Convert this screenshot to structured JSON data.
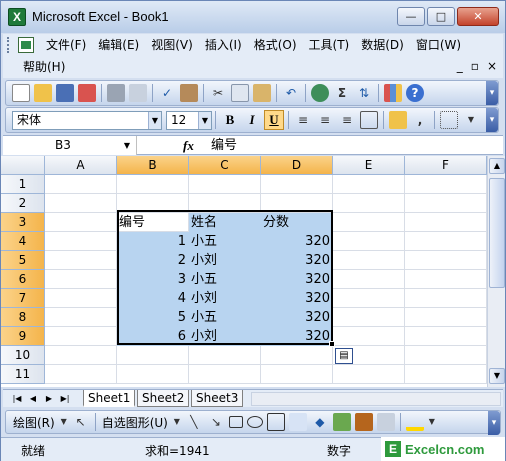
{
  "window": {
    "title": "Microsoft Excel - Book1",
    "app_icon_letter": "X",
    "minimize": "—",
    "maximize": "□",
    "close": "✕"
  },
  "menubar": {
    "items": [
      "文件(F)",
      "编辑(E)",
      "视图(V)",
      "插入(I)",
      "格式(O)",
      "工具(T)",
      "数据(D)",
      "窗口(W)"
    ],
    "help": "帮助(H)",
    "mdi": [
      "_",
      "▫",
      "×"
    ]
  },
  "standard_toolbar": {
    "icons": [
      "new-icon",
      "open-icon",
      "save-icon",
      "permission-icon",
      "print-icon",
      "print-preview-icon",
      "spelling-icon",
      "research-icon",
      "cut-icon",
      "copy-icon",
      "paste-icon",
      "undo-icon",
      "hyperlink-icon",
      "autosum-icon",
      "sort-icon",
      "chart-wizard-icon",
      "help-icon"
    ],
    "autosum_symbol": "Σ"
  },
  "formatting_toolbar": {
    "font": "宋体",
    "size": "12",
    "bold": "B",
    "italic": "I",
    "underline": "U",
    "comma": ","
  },
  "formula_bar": {
    "name_box": "B3",
    "fx": "fx",
    "content": "编号"
  },
  "columns": [
    "A",
    "B",
    "C",
    "D",
    "E",
    "F"
  ],
  "rows": [
    "1",
    "2",
    "3",
    "4",
    "5",
    "6",
    "7",
    "8",
    "9",
    "10",
    "11"
  ],
  "table": {
    "headers": [
      "编号",
      "姓名",
      "分数"
    ],
    "rows": [
      [
        "1",
        "小五",
        "320"
      ],
      [
        "2",
        "小刘",
        "320"
      ],
      [
        "3",
        "小五",
        "320"
      ],
      [
        "4",
        "小刘",
        "320"
      ],
      [
        "5",
        "小五",
        "320"
      ],
      [
        "6",
        "小刘",
        "320"
      ]
    ]
  },
  "sheets": [
    "Sheet1",
    "Sheet2",
    "Sheet3"
  ],
  "drawing_toolbar": {
    "draw": "绘图(R)",
    "autoshapes": "自选图形(U)"
  },
  "status": {
    "ready": "就绪",
    "sum": "求和=1941",
    "mode": "数字"
  },
  "logo": {
    "mark": "E",
    "text": "Excelcn.com"
  }
}
